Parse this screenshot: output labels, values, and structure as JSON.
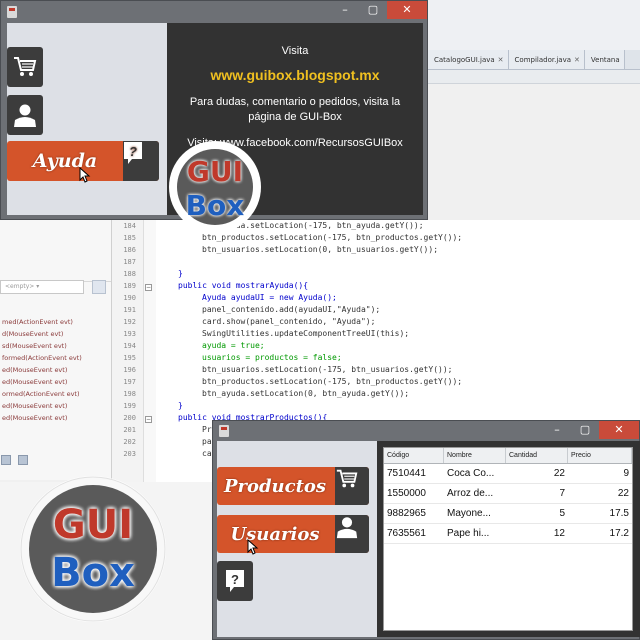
{
  "ide": {
    "tabs": [
      {
        "label": "CatalogoGUI.java"
      },
      {
        "label": "Compilador.java"
      },
      {
        "label": "Ventana"
      }
    ],
    "navigator": {
      "combo_value": "<empty>",
      "events": [
        "med(ActionEvent evt)",
        "d(MouseEvent evt)",
        "sd(MouseEvent evt)",
        "formed(ActionEvent evt)",
        "ed(MouseEvent evt)",
        "ed(MouseEvent evt)",
        "ormed(ActionEvent evt)",
        "ed(MouseEvent evt)",
        "ed(MouseEvent evt)"
      ]
    },
    "line_numbers": [
      "184",
      "185",
      "186",
      "187",
      "188",
      "189",
      "190",
      "191",
      "192",
      "193",
      "194",
      "195",
      "196",
      "197",
      "198",
      "199",
      "200",
      "201",
      "202",
      "203"
    ],
    "code_lines": [
      "btn_ayuda.setLocation(-175, btn_ayuda.getY());",
      "btn_productos.setLocation(-175, btn_productos.getY());",
      "btn_usuarios.setLocation(0, btn_usuarios.getY());",
      "",
      "}",
      "public void mostrarAyuda(){",
      "Ayuda ayudaUI = new Ayuda();",
      "panel_contenido.add(ayudaUI,\"Ayuda\");",
      "card.show(panel_contenido, \"Ayuda\");",
      "SwingUtilities.updateComponentTreeUI(this);",
      "ayuda = true;",
      "usuarios = productos = false;",
      "btn_usuarios.setLocation(-175, btn_usuarios.getY());",
      "btn_productos.setLocation(-175, btn_productos.getY());",
      "btn_ayuda.setLocation(0, btn_ayuda.getY());",
      "}",
      "public void mostrarProductos(){",
      "Pr",
      "pa",
      "ca"
    ]
  },
  "top_window": {
    "close_label": "✕",
    "minimize_label": "–",
    "maximize_label": "▢",
    "help_button_label": "Ayuda",
    "info": {
      "visit_label": "Visita",
      "url": "www.guibox.blogspot.mx",
      "message": "Para dudas, comentario o pedidos, visita la página de GUI-Box",
      "facebook": "Visita: www.facebook.com/RecursosGUIBox"
    },
    "logo_text_top": "GUI",
    "logo_text_bottom": "Box"
  },
  "bottom_window": {
    "close_label": "✕",
    "minimize_label": "–",
    "maximize_label": "▢",
    "products_button_label": "Productos",
    "users_button_label": "Usuarios",
    "table": {
      "columns": [
        "Código",
        "Nombre",
        "Cantidad",
        "Precio"
      ],
      "rows": [
        [
          "7510441",
          "Coca Co...",
          "22",
          "9"
        ],
        [
          "1550000",
          "Arroz de...",
          "7",
          "22"
        ],
        [
          "9882965",
          "Mayone...",
          "5",
          "17.5"
        ],
        [
          "7635561",
          "Pape hi...",
          "12",
          "17.2"
        ]
      ]
    }
  },
  "logo": {
    "text_top": "GUI",
    "text_bottom": "Box"
  },
  "colors": {
    "accent_orange": "#d4542a",
    "tile_dark": "#3c3c3c",
    "window_gray": "#6d7075",
    "close_red": "#c94b3a",
    "url_yellow": "#f0c020"
  }
}
